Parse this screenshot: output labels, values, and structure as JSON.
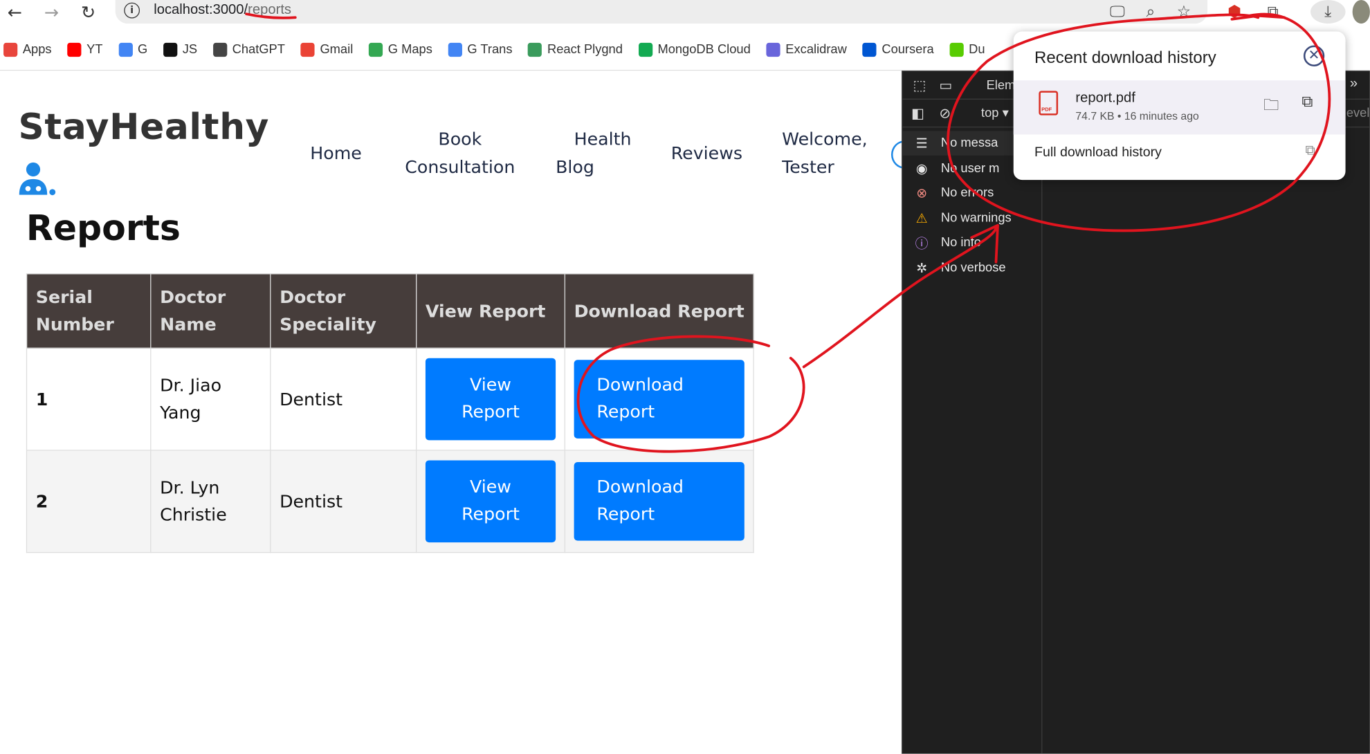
{
  "browser": {
    "url_host": "localhost:3000/",
    "url_path": "reports"
  },
  "bookmarks": [
    {
      "label": "Apps",
      "icon": "apps-grid-icon",
      "color": "#e8453c"
    },
    {
      "label": "YT",
      "icon": "youtube-icon",
      "color": "#ff0000"
    },
    {
      "label": "G",
      "icon": "google-icon",
      "color": "#4285f4"
    },
    {
      "label": "JS",
      "icon": "js-icon",
      "color": "#111111"
    },
    {
      "label": "ChatGPT",
      "icon": "chatgpt-icon",
      "color": "#444444"
    },
    {
      "label": "Gmail",
      "icon": "gmail-icon",
      "color": "#ea4335"
    },
    {
      "label": "G Maps",
      "icon": "maps-pin-icon",
      "color": "#34a853"
    },
    {
      "label": "G Trans",
      "icon": "translate-icon",
      "color": "#4285f4"
    },
    {
      "label": "React Plygnd",
      "icon": "react-playground-icon",
      "color": "#3a9b5c"
    },
    {
      "label": "MongoDB Cloud",
      "icon": "mongodb-icon",
      "color": "#13aa52"
    },
    {
      "label": "Excalidraw",
      "icon": "excalidraw-icon",
      "color": "#6965db"
    },
    {
      "label": "Coursera",
      "icon": "coursera-icon",
      "color": "#0056d2"
    },
    {
      "label": "Du",
      "icon": "duolingo-icon",
      "color": "#58cc02"
    }
  ],
  "site": {
    "brand": "StayHealthy",
    "nav": {
      "home": "Home",
      "book_1": "Book",
      "book_2": "Consultation",
      "health_1": "Health",
      "health_2": "Blog",
      "reviews": "Reviews",
      "welcome_1": "Welcome,",
      "welcome_2": "Tester"
    },
    "page_title": "Reports"
  },
  "table": {
    "headers": {
      "serial_1": "Serial",
      "serial_2": "Number",
      "doctor_1": "Doctor",
      "doctor_2": "Name",
      "spec_1": "Doctor",
      "spec_2": "Speciality",
      "view": "View Report",
      "download": "Download Report"
    },
    "rows": [
      {
        "serial": "1",
        "name_1": "Dr. Jiao",
        "name_2": "Yang",
        "speciality": "Dentist",
        "view_1": "View",
        "view_2": "Report",
        "dl_1": "Download",
        "dl_2": "Report"
      },
      {
        "serial": "2",
        "name_1": "Dr. Lyn",
        "name_2": "Christie",
        "speciality": "Dentist",
        "view_1": "View",
        "view_2": "Report",
        "dl_1": "Download",
        "dl_2": "Report"
      }
    ]
  },
  "devtools": {
    "tab_elements": "Elem",
    "context": "top",
    "levels": "evels",
    "filters": [
      {
        "label": "No messa",
        "icon": "list-icon"
      },
      {
        "label": "No user m",
        "icon": "user-icon"
      },
      {
        "label": "No errors",
        "icon": "error-icon"
      },
      {
        "label": "No warnings",
        "icon": "warning-icon"
      },
      {
        "label": "No info",
        "icon": "info-icon"
      },
      {
        "label": "No verbose",
        "icon": "bug-icon"
      }
    ]
  },
  "download_popup": {
    "title": "Recent download history",
    "file_name": "report.pdf",
    "file_meta": "74.7 KB • 16 minutes ago",
    "full_history": "Full download history"
  },
  "colors": {
    "accent": "#007bff",
    "table_header": "#463d3b",
    "annotation": "#e0141e"
  }
}
